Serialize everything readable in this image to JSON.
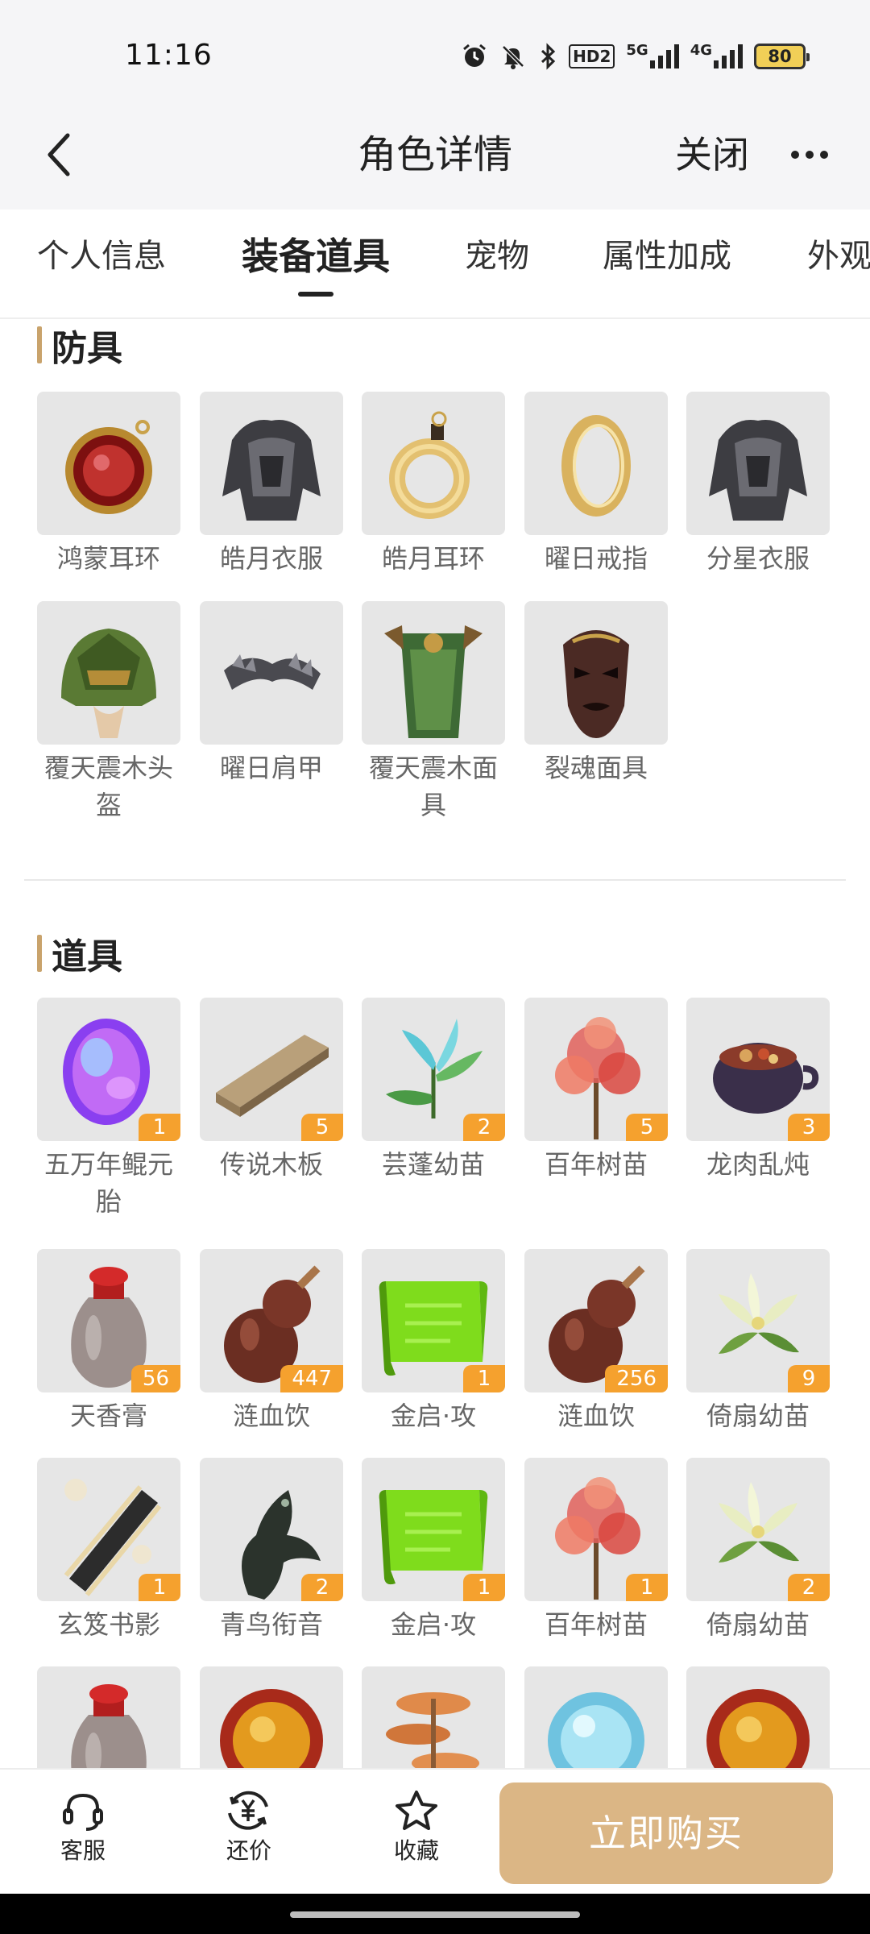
{
  "status_bar": {
    "time": "11:16",
    "hd_label": "HD2",
    "net1_label": "5G",
    "net2_label": "4G",
    "battery": "80"
  },
  "nav": {
    "title": "角色详情",
    "close_label": "关闭"
  },
  "tabs": [
    {
      "label": "个人信息"
    },
    {
      "label": "装备道具"
    },
    {
      "label": "宠物"
    },
    {
      "label": "属性加成"
    },
    {
      "label": "外观"
    }
  ],
  "armor": {
    "title": "防具",
    "items": [
      {
        "name": "鸿蒙耳环",
        "icon": "red-earring-icon"
      },
      {
        "name": "皓月衣服",
        "icon": "dark-armor-icon"
      },
      {
        "name": "皓月耳环",
        "icon": "gold-ring-earring-icon"
      },
      {
        "name": "曜日戒指",
        "icon": "gold-ring-icon"
      },
      {
        "name": "分星衣服",
        "icon": "dark-armor-icon"
      },
      {
        "name": "覆天震木头盔",
        "icon": "green-helmet-icon"
      },
      {
        "name": "曜日肩甲",
        "icon": "shoulder-armor-icon"
      },
      {
        "name": "覆天震木面具",
        "icon": "green-mask-armor-icon"
      },
      {
        "name": "裂魂面具",
        "icon": "demon-mask-icon"
      }
    ]
  },
  "props": {
    "title": "道具",
    "items": [
      {
        "name": "五万年鲲元胎",
        "count": "1",
        "icon": "purple-egg-icon"
      },
      {
        "name": "传说木板",
        "count": "5",
        "icon": "wood-plank-icon"
      },
      {
        "name": "芸蓬幼苗",
        "count": "2",
        "icon": "blue-sprout-icon"
      },
      {
        "name": "百年树苗",
        "count": "5",
        "icon": "red-tree-icon"
      },
      {
        "name": "龙肉乱炖",
        "count": "3",
        "icon": "stew-pot-icon"
      },
      {
        "name": "天香膏",
        "count": "56",
        "icon": "ointment-jar-icon"
      },
      {
        "name": "涟血饮",
        "count": "447",
        "icon": "gourd-icon"
      },
      {
        "name": "金启·攻",
        "count": "1",
        "icon": "green-scroll-icon"
      },
      {
        "name": "涟血饮",
        "count": "256",
        "icon": "gourd-icon"
      },
      {
        "name": "倚扇幼苗",
        "count": "9",
        "icon": "white-flower-icon"
      },
      {
        "name": "玄笈书影",
        "count": "1",
        "icon": "book-shadow-icon"
      },
      {
        "name": "青鸟衔音",
        "count": "2",
        "icon": "bird-whistle-icon"
      },
      {
        "name": "金启·攻",
        "count": "1",
        "icon": "green-scroll-icon"
      },
      {
        "name": "百年树苗",
        "count": "1",
        "icon": "red-tree-icon"
      },
      {
        "name": "倚扇幼苗",
        "count": "2",
        "icon": "white-flower-icon"
      },
      {
        "name": "",
        "count": "",
        "icon": "ointment-jar-icon"
      },
      {
        "name": "",
        "count": "",
        "icon": "amber-orb-icon"
      },
      {
        "name": "",
        "count": "",
        "icon": "orange-mushroom-icon"
      },
      {
        "name": "",
        "count": "",
        "icon": "ice-orb-icon"
      },
      {
        "name": "",
        "count": "",
        "icon": "amber-orb-icon"
      }
    ]
  },
  "bottom_bar": {
    "service_label": "客服",
    "bargain_label": "还价",
    "favorite_label": "收藏",
    "buy_label": "立即购买"
  },
  "colors": {
    "accent": "#c9a36c",
    "buy_button": "#dbb685",
    "badge": "#f5a12e"
  }
}
